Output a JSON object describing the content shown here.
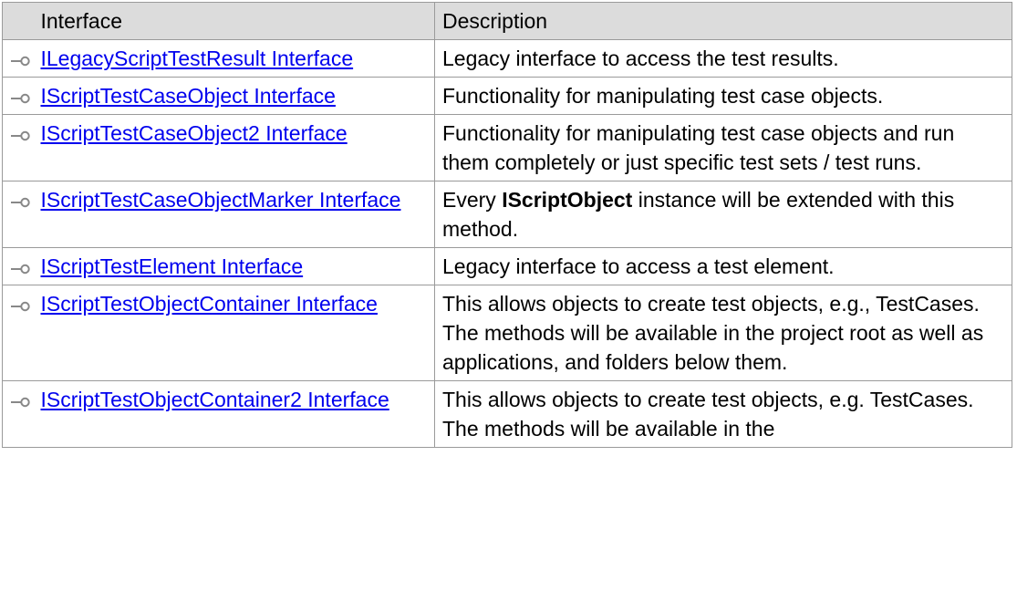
{
  "header": {
    "icon_col": "",
    "interface_col": "Interface",
    "description_col": "Description"
  },
  "rows": [
    {
      "name": "ILegacyScriptTestResult Interface",
      "desc": "Legacy interface to access the test results."
    },
    {
      "name": "IScriptTestCaseObject Interface",
      "desc": "Functionality for manipulating test case objects."
    },
    {
      "name": "IScriptTestCaseObject2 Interface",
      "desc": "Functionality for manipulating test case objects and run them completely or just specific test sets / test runs."
    },
    {
      "name": "IScriptTestCaseObjectMarker Interface",
      "desc_pre": "Every ",
      "desc_bold": "IScriptObject",
      "desc_post": " instance will be extended with this method."
    },
    {
      "name": "IScriptTestElement Interface",
      "desc": "Legacy interface to access a test element."
    },
    {
      "name": "IScriptTestObjectContainer Interface",
      "desc": "This allows objects to create test objects, e.g., TestCases. The methods will be available in the project root as well as applications, and folders below them."
    },
    {
      "name": "IScriptTestObjectContainer2 Interface",
      "desc": "This allows objects to create test objects, e.g. TestCases. The methods will be available in the"
    }
  ],
  "icons": {
    "row_icon": "interface-lollipop-icon"
  },
  "colors": {
    "header_bg": "#dcdcdc",
    "link": "#0000ee",
    "border": "#9a9a9a"
  }
}
